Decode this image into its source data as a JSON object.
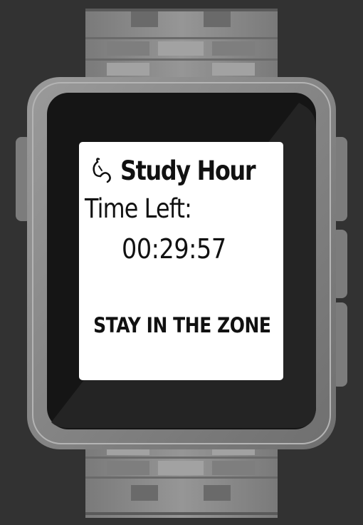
{
  "app": {
    "title": "Study Hour",
    "title_icon": "stopwatch-icon"
  },
  "timer": {
    "label": "Time Left:",
    "remaining": "00:29:57"
  },
  "message": "STAY IN THE ZONE",
  "colors": {
    "screen_background": "#ffffff",
    "text": "#111111",
    "watch_body": "#8a8a8a",
    "watch_bezel": "#1b1b1b",
    "page_background": "#323232"
  }
}
